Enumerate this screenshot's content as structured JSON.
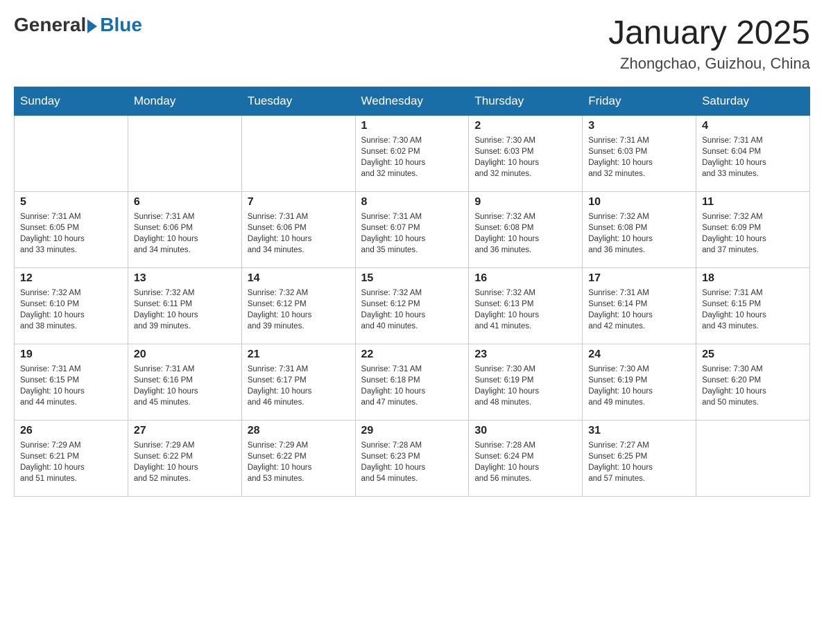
{
  "header": {
    "logo_general": "General",
    "logo_blue": "Blue",
    "month_title": "January 2025",
    "location": "Zhongchao, Guizhou, China"
  },
  "days_of_week": [
    "Sunday",
    "Monday",
    "Tuesday",
    "Wednesday",
    "Thursday",
    "Friday",
    "Saturday"
  ],
  "weeks": [
    [
      {
        "day": "",
        "info": ""
      },
      {
        "day": "",
        "info": ""
      },
      {
        "day": "",
        "info": ""
      },
      {
        "day": "1",
        "info": "Sunrise: 7:30 AM\nSunset: 6:02 PM\nDaylight: 10 hours\nand 32 minutes."
      },
      {
        "day": "2",
        "info": "Sunrise: 7:30 AM\nSunset: 6:03 PM\nDaylight: 10 hours\nand 32 minutes."
      },
      {
        "day": "3",
        "info": "Sunrise: 7:31 AM\nSunset: 6:03 PM\nDaylight: 10 hours\nand 32 minutes."
      },
      {
        "day": "4",
        "info": "Sunrise: 7:31 AM\nSunset: 6:04 PM\nDaylight: 10 hours\nand 33 minutes."
      }
    ],
    [
      {
        "day": "5",
        "info": "Sunrise: 7:31 AM\nSunset: 6:05 PM\nDaylight: 10 hours\nand 33 minutes."
      },
      {
        "day": "6",
        "info": "Sunrise: 7:31 AM\nSunset: 6:06 PM\nDaylight: 10 hours\nand 34 minutes."
      },
      {
        "day": "7",
        "info": "Sunrise: 7:31 AM\nSunset: 6:06 PM\nDaylight: 10 hours\nand 34 minutes."
      },
      {
        "day": "8",
        "info": "Sunrise: 7:31 AM\nSunset: 6:07 PM\nDaylight: 10 hours\nand 35 minutes."
      },
      {
        "day": "9",
        "info": "Sunrise: 7:32 AM\nSunset: 6:08 PM\nDaylight: 10 hours\nand 36 minutes."
      },
      {
        "day": "10",
        "info": "Sunrise: 7:32 AM\nSunset: 6:08 PM\nDaylight: 10 hours\nand 36 minutes."
      },
      {
        "day": "11",
        "info": "Sunrise: 7:32 AM\nSunset: 6:09 PM\nDaylight: 10 hours\nand 37 minutes."
      }
    ],
    [
      {
        "day": "12",
        "info": "Sunrise: 7:32 AM\nSunset: 6:10 PM\nDaylight: 10 hours\nand 38 minutes."
      },
      {
        "day": "13",
        "info": "Sunrise: 7:32 AM\nSunset: 6:11 PM\nDaylight: 10 hours\nand 39 minutes."
      },
      {
        "day": "14",
        "info": "Sunrise: 7:32 AM\nSunset: 6:12 PM\nDaylight: 10 hours\nand 39 minutes."
      },
      {
        "day": "15",
        "info": "Sunrise: 7:32 AM\nSunset: 6:12 PM\nDaylight: 10 hours\nand 40 minutes."
      },
      {
        "day": "16",
        "info": "Sunrise: 7:32 AM\nSunset: 6:13 PM\nDaylight: 10 hours\nand 41 minutes."
      },
      {
        "day": "17",
        "info": "Sunrise: 7:31 AM\nSunset: 6:14 PM\nDaylight: 10 hours\nand 42 minutes."
      },
      {
        "day": "18",
        "info": "Sunrise: 7:31 AM\nSunset: 6:15 PM\nDaylight: 10 hours\nand 43 minutes."
      }
    ],
    [
      {
        "day": "19",
        "info": "Sunrise: 7:31 AM\nSunset: 6:15 PM\nDaylight: 10 hours\nand 44 minutes."
      },
      {
        "day": "20",
        "info": "Sunrise: 7:31 AM\nSunset: 6:16 PM\nDaylight: 10 hours\nand 45 minutes."
      },
      {
        "day": "21",
        "info": "Sunrise: 7:31 AM\nSunset: 6:17 PM\nDaylight: 10 hours\nand 46 minutes."
      },
      {
        "day": "22",
        "info": "Sunrise: 7:31 AM\nSunset: 6:18 PM\nDaylight: 10 hours\nand 47 minutes."
      },
      {
        "day": "23",
        "info": "Sunrise: 7:30 AM\nSunset: 6:19 PM\nDaylight: 10 hours\nand 48 minutes."
      },
      {
        "day": "24",
        "info": "Sunrise: 7:30 AM\nSunset: 6:19 PM\nDaylight: 10 hours\nand 49 minutes."
      },
      {
        "day": "25",
        "info": "Sunrise: 7:30 AM\nSunset: 6:20 PM\nDaylight: 10 hours\nand 50 minutes."
      }
    ],
    [
      {
        "day": "26",
        "info": "Sunrise: 7:29 AM\nSunset: 6:21 PM\nDaylight: 10 hours\nand 51 minutes."
      },
      {
        "day": "27",
        "info": "Sunrise: 7:29 AM\nSunset: 6:22 PM\nDaylight: 10 hours\nand 52 minutes."
      },
      {
        "day": "28",
        "info": "Sunrise: 7:29 AM\nSunset: 6:22 PM\nDaylight: 10 hours\nand 53 minutes."
      },
      {
        "day": "29",
        "info": "Sunrise: 7:28 AM\nSunset: 6:23 PM\nDaylight: 10 hours\nand 54 minutes."
      },
      {
        "day": "30",
        "info": "Sunrise: 7:28 AM\nSunset: 6:24 PM\nDaylight: 10 hours\nand 56 minutes."
      },
      {
        "day": "31",
        "info": "Sunrise: 7:27 AM\nSunset: 6:25 PM\nDaylight: 10 hours\nand 57 minutes."
      },
      {
        "day": "",
        "info": ""
      }
    ]
  ]
}
